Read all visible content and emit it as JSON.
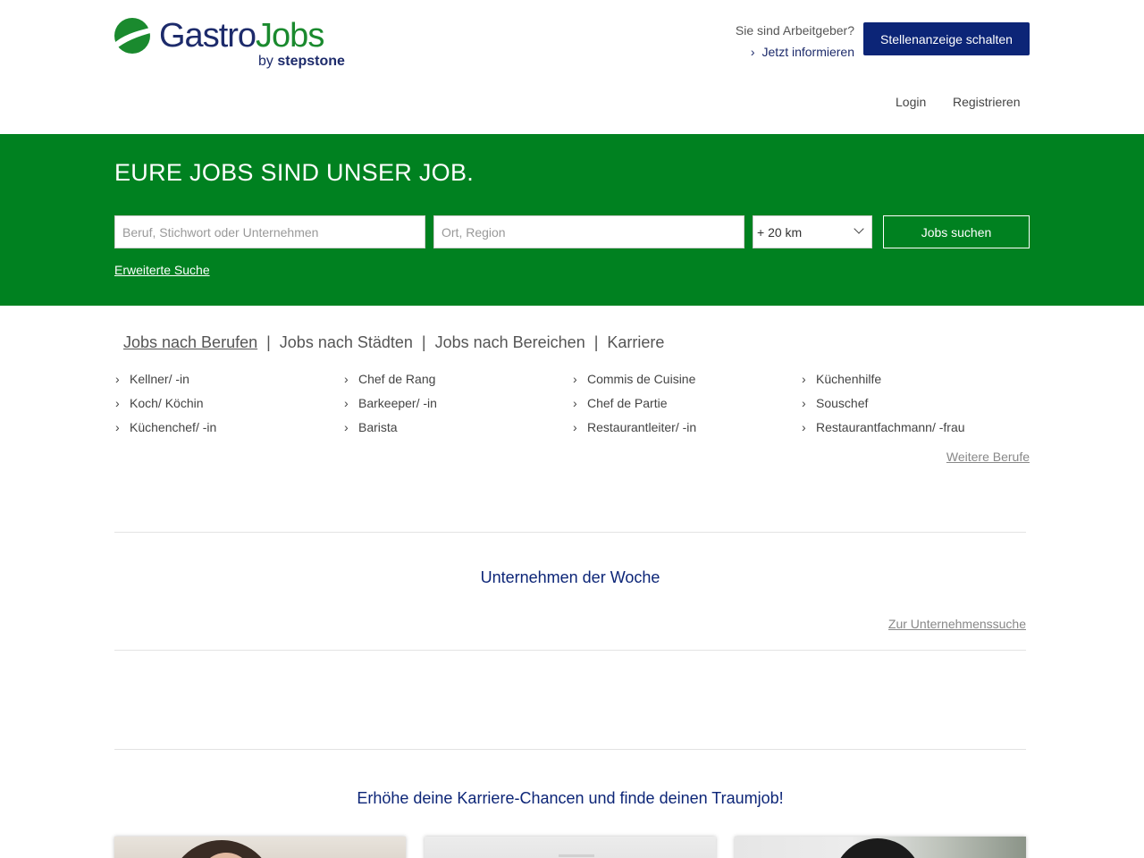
{
  "brand": {
    "logo_gastro": "Gastro",
    "logo_jobs": "Jobs",
    "logo_by": "by",
    "logo_stepstone": "stepstone"
  },
  "header": {
    "employer_question": "Sie sind Arbeitgeber?",
    "employer_link": "Jetzt informieren",
    "post_ad_button": "Stellenanzeige schalten",
    "login": "Login",
    "register": "Registrieren"
  },
  "hero": {
    "title": "EURE JOBS SIND UNSER JOB.",
    "keyword_placeholder": "Beruf, Stichwort oder Unternehmen",
    "location_placeholder": "Ort, Region",
    "radius_value": "+ 20 km",
    "search_button": "Jobs suchen",
    "advanced_search": "Erweiterte Suche"
  },
  "tabs": [
    {
      "label": "Jobs nach Berufen",
      "active": true
    },
    {
      "label": "Jobs nach Städten",
      "active": false
    },
    {
      "label": "Jobs nach Bereichen",
      "active": false
    },
    {
      "label": "Karriere",
      "active": false
    }
  ],
  "jobs": {
    "columns": [
      [
        "Kellner/ -in",
        "Koch/ Köchin",
        "Küchenchef/ -in"
      ],
      [
        "Chef de Rang",
        "Barkeeper/ -in",
        "Barista"
      ],
      [
        "Commis de Cuisine",
        "Chef de Partie",
        "Restaurantleiter/ -in"
      ],
      [
        "Küchenhilfe",
        "Souschef",
        "Restaurantfachmann/ -frau"
      ]
    ],
    "more_link": "Weitere Berufe"
  },
  "companies": {
    "title": "Unternehmen der Woche",
    "search_link": "Zur Unternehmenssuche"
  },
  "career": {
    "title": "Erhöhe deine Karriere-Chancen und finde deinen Traumjob!"
  },
  "colors": {
    "brand_green": "#008120",
    "brand_navy": "#0c2577",
    "logo_green": "#1a8a2e"
  },
  "icons": {
    "chevron": "chevron-right-icon",
    "select_caret": "chevron-down-icon"
  }
}
